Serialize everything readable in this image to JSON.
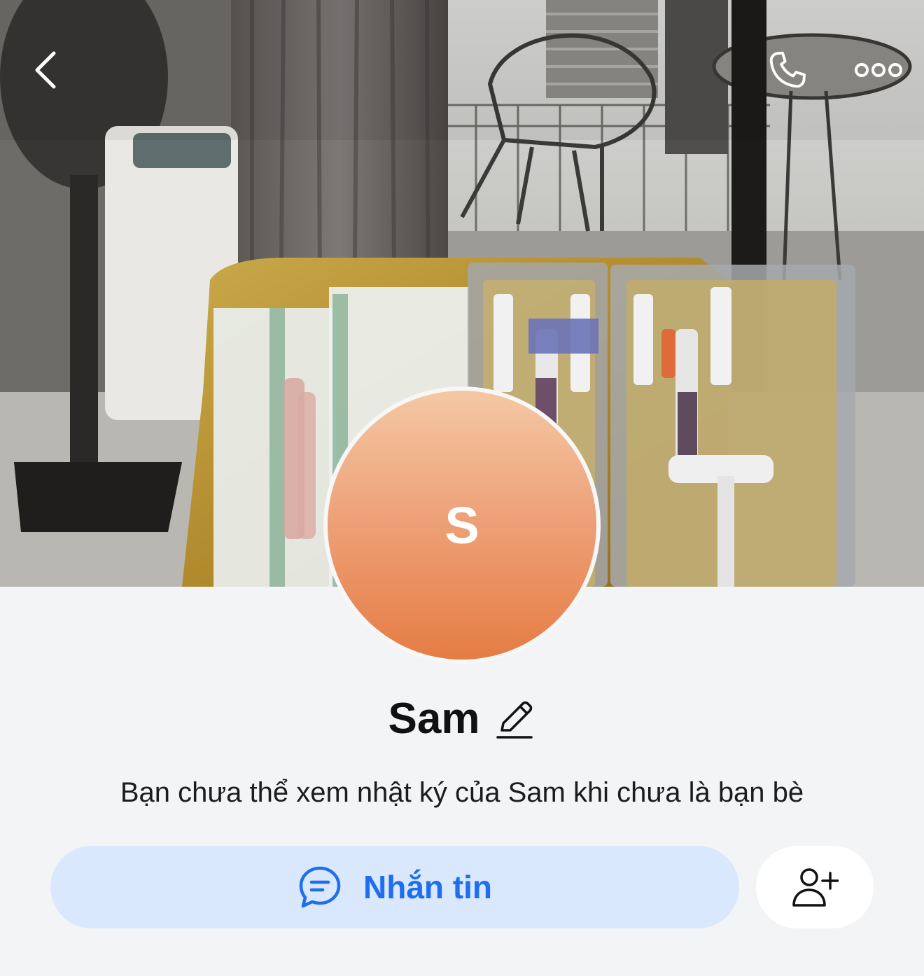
{
  "header": {
    "back_icon": "chevron-left-icon",
    "call_icon": "phone-icon",
    "more_icon": "more-dots-icon"
  },
  "profile": {
    "avatar_initial": "S",
    "name": "Sam",
    "edit_icon": "pencil-icon",
    "notice": "Bạn chưa thể xem nhật ký của Sam khi chưa là bạn bè"
  },
  "actions": {
    "message_label": "Nhắn tin",
    "message_icon": "chat-bubble-icon",
    "add_friend_icon": "add-friend-icon"
  },
  "colors": {
    "accent": "#1f6ef0",
    "message_button_bg": "#d9e8fc",
    "avatar_top": "#f4c8a4",
    "avatar_bottom": "#e57c44",
    "page_bg": "#f3f4f6"
  }
}
